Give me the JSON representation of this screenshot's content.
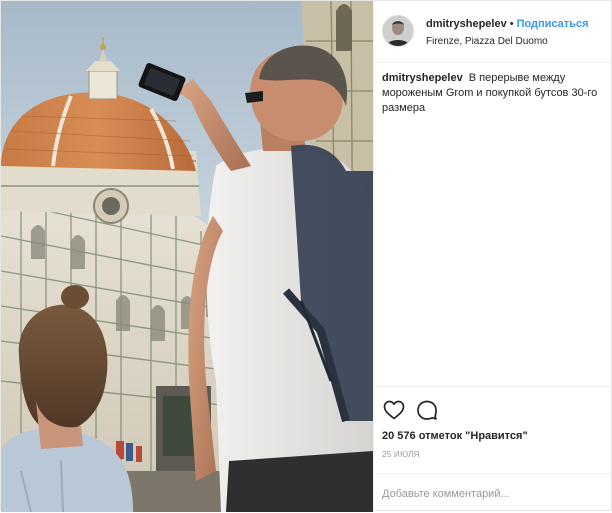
{
  "post": {
    "username": "dmitryshepelev",
    "separator": "•",
    "follow_label": "Подписаться",
    "location": "Firenze, Piazza Del Duomo",
    "caption_text": "В перерыве между мороженым Grom и покупкой бутсов 30-го размера",
    "likes_text": "20 576 отметок \"Нравится\"",
    "date": "25 июля",
    "comment_placeholder": "Добавьте комментарий..."
  },
  "icons": {
    "like": "heart-outline-icon",
    "comment": "comment-bubble-icon"
  },
  "colors": {
    "accent": "#3897f0",
    "text": "#262626",
    "muted": "#999999",
    "divider": "#efefef"
  }
}
